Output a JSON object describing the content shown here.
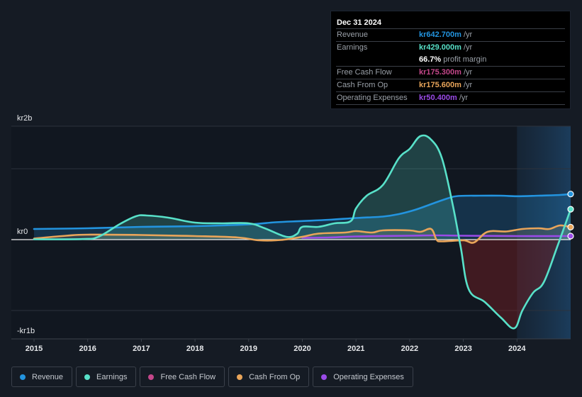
{
  "chart_data": {
    "type": "line",
    "title": "",
    "xlabel": "",
    "ylabel": "",
    "x_range": [
      2015,
      2025
    ],
    "y_range_millions": [
      -1400,
      1600
    ],
    "y_tick_labels": [
      {
        "label": "kr2b",
        "position": "top"
      },
      {
        "label": "kr0",
        "value": 0
      },
      {
        "label": "-kr1b",
        "position": "bottom"
      }
    ],
    "gridline_values_millions": [
      1600,
      1000,
      0,
      -1000,
      -1400
    ],
    "x_ticks": [
      2015,
      2016,
      2017,
      2018,
      2019,
      2020,
      2021,
      2022,
      2023,
      2024
    ],
    "x_tick_labels": [
      "2015",
      "2016",
      "2017",
      "2018",
      "2019",
      "2020",
      "2021",
      "2022",
      "2023",
      "2024"
    ],
    "highlight_region_start": 2024,
    "units": "kr millions",
    "series": [
      {
        "name": "Revenue",
        "key": "revenue",
        "color": "#2394df",
        "fill": true,
        "points": [
          [
            2015,
            150
          ],
          [
            2016,
            160
          ],
          [
            2017,
            180
          ],
          [
            2018,
            190
          ],
          [
            2019,
            215
          ],
          [
            2019.5,
            245
          ],
          [
            2020,
            262
          ],
          [
            2020.5,
            280
          ],
          [
            2021,
            305
          ],
          [
            2021.5,
            325
          ],
          [
            2021.8,
            360
          ],
          [
            2022.1,
            420
          ],
          [
            2022.4,
            500
          ],
          [
            2022.7,
            580
          ],
          [
            2022.9,
            615
          ],
          [
            2023.3,
            620
          ],
          [
            2023.7,
            620
          ],
          [
            2024,
            612
          ],
          [
            2024.4,
            620
          ],
          [
            2024.8,
            630
          ],
          [
            2025,
            643
          ]
        ]
      },
      {
        "name": "Earnings",
        "key": "earnings",
        "color": "#58e1c9",
        "fill": true,
        "points": [
          [
            2015,
            5
          ],
          [
            2015.9,
            8
          ],
          [
            2016.2,
            40
          ],
          [
            2016.6,
            220
          ],
          [
            2016.9,
            330
          ],
          [
            2017.1,
            340
          ],
          [
            2017.5,
            310
          ],
          [
            2018,
            240
          ],
          [
            2018.5,
            230
          ],
          [
            2019,
            230
          ],
          [
            2019.3,
            160
          ],
          [
            2019.7,
            40
          ],
          [
            2019.9,
            80
          ],
          [
            2020.0,
            180
          ],
          [
            2020.3,
            180
          ],
          [
            2020.6,
            230
          ],
          [
            2020.9,
            260
          ],
          [
            2021.0,
            440
          ],
          [
            2021.2,
            620
          ],
          [
            2021.5,
            770
          ],
          [
            2021.8,
            1150
          ],
          [
            2022.0,
            1280
          ],
          [
            2022.2,
            1460
          ],
          [
            2022.4,
            1410
          ],
          [
            2022.6,
            1150
          ],
          [
            2022.8,
            500
          ],
          [
            2022.95,
            -100
          ],
          [
            2023.1,
            -700
          ],
          [
            2023.4,
            -880
          ],
          [
            2023.7,
            -1100
          ],
          [
            2023.95,
            -1250
          ],
          [
            2024.1,
            -1000
          ],
          [
            2024.3,
            -750
          ],
          [
            2024.5,
            -600
          ],
          [
            2024.75,
            -100
          ],
          [
            2025,
            429
          ]
        ]
      },
      {
        "name": "Free Cash Flow",
        "key": "fcf",
        "color": "#c4478a",
        "fill": false,
        "points": [
          [
            2025,
            175.3
          ]
        ]
      },
      {
        "name": "Cash From Op",
        "key": "cfo",
        "color": "#e9a55a",
        "fill": true,
        "points": [
          [
            2015,
            15
          ],
          [
            2015.6,
            55
          ],
          [
            2016,
            70
          ],
          [
            2017,
            65
          ],
          [
            2018,
            50
          ],
          [
            2018.8,
            30
          ],
          [
            2019.2,
            -10
          ],
          [
            2019.6,
            -5
          ],
          [
            2020,
            40
          ],
          [
            2020.3,
            85
          ],
          [
            2020.8,
            100
          ],
          [
            2021,
            120
          ],
          [
            2021.3,
            100
          ],
          [
            2021.5,
            130
          ],
          [
            2022,
            130
          ],
          [
            2022.2,
            110
          ],
          [
            2022.4,
            150
          ],
          [
            2022.5,
            0
          ],
          [
            2022.6,
            -25
          ],
          [
            2023,
            -10
          ],
          [
            2023.2,
            -40
          ],
          [
            2023.45,
            110
          ],
          [
            2023.8,
            115
          ],
          [
            2024.1,
            150
          ],
          [
            2024.4,
            160
          ],
          [
            2024.6,
            150
          ],
          [
            2024.8,
            200
          ],
          [
            2025,
            176
          ]
        ]
      },
      {
        "name": "Operating Expenses",
        "key": "opex",
        "color": "#9a4be8",
        "fill": false,
        "points": [
          [
            2020,
            25
          ],
          [
            2020.5,
            30
          ],
          [
            2021,
            45
          ],
          [
            2022,
            55
          ],
          [
            2022.5,
            60
          ],
          [
            2023,
            55
          ],
          [
            2024,
            50
          ],
          [
            2025,
            50
          ]
        ]
      }
    ]
  },
  "tooltip": {
    "date": "Dec 31 2024",
    "rows": [
      {
        "label": "Revenue",
        "value": "kr642.700m",
        "unit": "/yr",
        "color": "#2394df"
      },
      {
        "label": "Earnings",
        "value": "kr429.000m",
        "unit": "/yr",
        "color": "#58e1c9"
      },
      {
        "label": "",
        "value": "66.7%",
        "unit": "profit margin",
        "color": "#ffffff"
      },
      {
        "label": "Free Cash Flow",
        "value": "kr175.300m",
        "unit": "/yr",
        "color": "#c4478a"
      },
      {
        "label": "Cash From Op",
        "value": "kr175.600m",
        "unit": "/yr",
        "color": "#e9a55a"
      },
      {
        "label": "Operating Expenses",
        "value": "kr50.400m",
        "unit": "/yr",
        "color": "#9a4be8"
      }
    ]
  },
  "legend": [
    {
      "label": "Revenue",
      "color": "#2394df"
    },
    {
      "label": "Earnings",
      "color": "#58e1c9"
    },
    {
      "label": "Free Cash Flow",
      "color": "#c4478a"
    },
    {
      "label": "Cash From Op",
      "color": "#e9a55a"
    },
    {
      "label": "Operating Expenses",
      "color": "#9a4be8"
    }
  ]
}
